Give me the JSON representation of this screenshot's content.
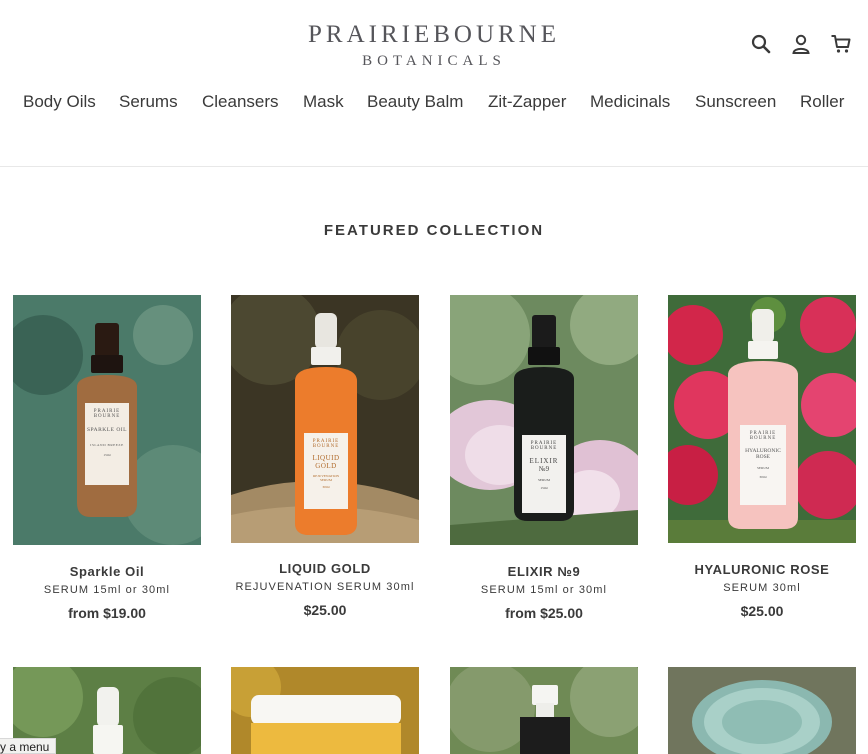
{
  "brand": {
    "line1": "PRAIRIEBOURNE",
    "line2": "BOTANICALS"
  },
  "header_icons": {
    "search": "search-icon",
    "account": "person-icon",
    "cart": "cart-icon"
  },
  "nav": [
    "Body Oils",
    "Serums",
    "Cleansers",
    "Mask",
    "Beauty Balm",
    "Zit-Zapper",
    "Medicinals",
    "Sunscreen",
    "Roller"
  ],
  "featured": {
    "title": "FEATURED COLLECTION",
    "products": [
      {
        "title": "Sparkle Oil",
        "subtitle": "SERUM 15ml or 30ml",
        "price": "from $19.00",
        "label": [
          "PRAIRIE",
          "BOURNE",
          "SPARKLE OIL",
          "ISLAND BREEZE",
          "15ml"
        ]
      },
      {
        "title": "LIQUID GOLD",
        "subtitle": "REJUVENATION SERUM 30ml",
        "price": "$25.00",
        "label": [
          "PRAIRIE",
          "BOURNE",
          "LIQUID",
          "GOLD",
          "REJUVENATION",
          "SERUM",
          "30ml"
        ]
      },
      {
        "title": "ELIXIR №9",
        "subtitle": "SERUM 15ml or 30ml",
        "price": "from $25.00",
        "label": [
          "PRAIRIE",
          "BOURNE",
          "ELIXIR",
          "№9",
          "SERUM",
          "15ml"
        ]
      },
      {
        "title": "HYALURONIC ROSE",
        "subtitle": "SERUM 30ml",
        "price": "$25.00",
        "label": [
          "PRAIRIE",
          "BOURNE",
          "HYALURONIC",
          "ROSE",
          "SERUM",
          "30ml"
        ]
      }
    ]
  },
  "accessibility_tab": "y a menu",
  "colors": {
    "text": "#3a3a3a",
    "logo": "#55555a",
    "divider": "#e8e8e8"
  }
}
